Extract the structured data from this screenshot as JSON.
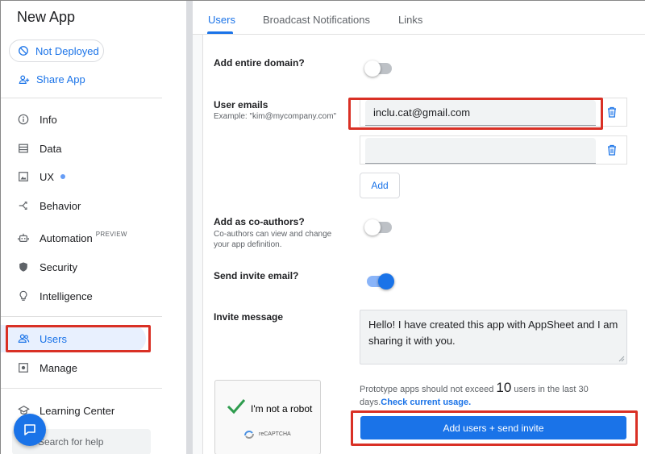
{
  "app": {
    "title": "New App"
  },
  "sidebar": {
    "deploy_status": "Not Deployed",
    "share_label": "Share App",
    "items": [
      {
        "label": "Info",
        "icon": "info-icon"
      },
      {
        "label": "Data",
        "icon": "table-icon"
      },
      {
        "label": "UX",
        "icon": "image-icon"
      },
      {
        "label": "Behavior",
        "icon": "branch-icon"
      },
      {
        "label": "Automation",
        "icon": "robot-icon",
        "tag": "PREVIEW"
      },
      {
        "label": "Security",
        "icon": "shield-icon"
      },
      {
        "label": "Intelligence",
        "icon": "lightbulb-icon"
      },
      {
        "label": "Users",
        "icon": "people-icon",
        "active": true
      },
      {
        "label": "Manage",
        "icon": "gear-icon"
      },
      {
        "label": "Learning Center",
        "icon": "school-icon"
      }
    ],
    "search_placeholder": "Search for help"
  },
  "tabs": [
    "Users",
    "Broadcast Notifications",
    "Links"
  ],
  "form": {
    "domain_label": "Add entire domain?",
    "domain_on": false,
    "emails_label": "User emails",
    "emails_hint": "Example: \"kim@mycompany.com\"",
    "emails": [
      "inclu.cat@gmail.com",
      ""
    ],
    "add_label": "Add",
    "coauthors_label": "Add as co-authors?",
    "coauthors_hint_1": "Co-authors can view and change",
    "coauthors_hint_2": "your app definition.",
    "coauthors_on": false,
    "send_invite_label": "Send invite email?",
    "send_invite_on": true,
    "message_label": "Invite message",
    "message_value": "Hello! I have created this app with AppSheet and I am sharing it with you.",
    "captcha_label": "I'm not a robot",
    "captcha_brand": "reCAPTCHA",
    "limit_prefix": "Prototype apps should not exceed",
    "limit_number": "10",
    "limit_suffix": "users in the last 30 days.",
    "limit_link": "Check current usage.",
    "invite_button": "Add users + send invite"
  },
  "colors": {
    "accent": "#1a73e8",
    "highlight": "#d93025"
  }
}
